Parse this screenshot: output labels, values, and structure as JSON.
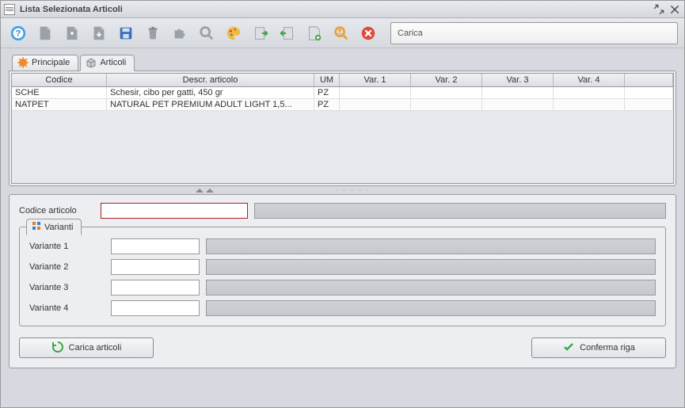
{
  "window": {
    "title": "Lista Selezionata Articoli"
  },
  "toolbar": {
    "carica_label": "Carica"
  },
  "tabs": {
    "principale": "Principale",
    "articoli": "Articoli"
  },
  "grid": {
    "headers": {
      "codice": "Codice",
      "descr": "Descr. articolo",
      "um": "UM",
      "var1": "Var. 1",
      "var2": "Var. 2",
      "var3": "Var. 3",
      "var4": "Var. 4"
    },
    "rows": [
      {
        "codice": "SCHE",
        "descr": "Schesir, cibo per gatti, 450 gr",
        "um": "PZ",
        "var1": "",
        "var2": "",
        "var3": "",
        "var4": ""
      },
      {
        "codice": "NATPET",
        "descr": "NATURAL PET PREMIUM ADULT LIGHT 1,5...",
        "um": "PZ",
        "var1": "",
        "var2": "",
        "var3": "",
        "var4": ""
      }
    ]
  },
  "detail": {
    "codice_label": "Codice articolo",
    "codice_value": "",
    "varianti_tab": "Varianti",
    "variants": {
      "v1_label": "Variante 1",
      "v1_value": "",
      "v2_label": "Variante 2",
      "v2_value": "",
      "v3_label": "Variante 3",
      "v3_value": "",
      "v4_label": "Variante 4",
      "v4_value": ""
    },
    "carica_articoli": "Carica articoli",
    "conferma_riga": "Conferma riga"
  }
}
